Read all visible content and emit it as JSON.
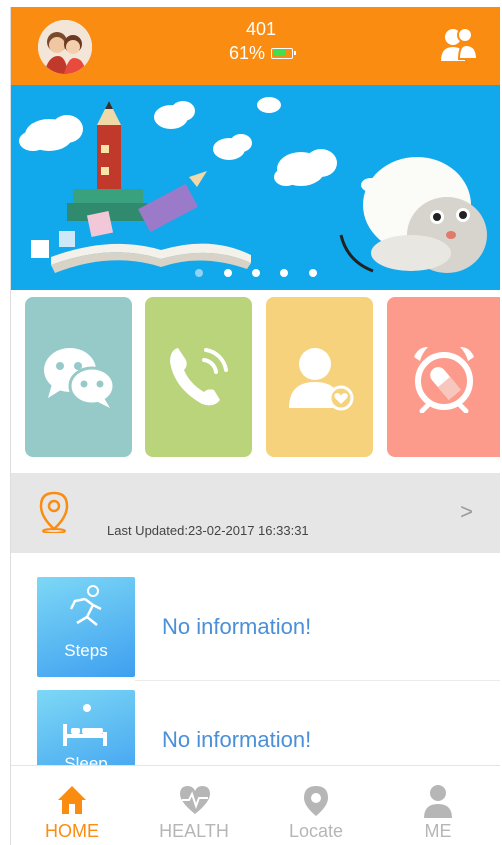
{
  "header": {
    "device_id": "401",
    "battery_percent": "61%",
    "avatar_icon": "family-avatar",
    "contacts_icon": "contacts-icon",
    "brand_color": "#fb8c12"
  },
  "banner": {
    "slide_count": 5,
    "active_slide": 0
  },
  "quick_actions": [
    {
      "icon": "chat-icon",
      "color": "#96cac9"
    },
    {
      "icon": "phone-call-icon",
      "color": "#b9d47b"
    },
    {
      "icon": "contact-heart-icon",
      "color": "#f6d27c"
    },
    {
      "icon": "alarm-pill-icon",
      "color": "#fc9a8b"
    }
  ],
  "location": {
    "text": "Last Updated:23-02-2017 16:33:31",
    "arrow": ">"
  },
  "info_cards": [
    {
      "label": "Steps",
      "value": "No information!"
    },
    {
      "label": "Sleep",
      "value": "No information!"
    }
  ],
  "nav": {
    "items": [
      {
        "label": "HOME",
        "icon": "home-icon",
        "active": true
      },
      {
        "label": "HEALTH",
        "icon": "heart-pulse-icon",
        "active": false
      },
      {
        "label": "Locate",
        "icon": "location-pin-icon",
        "active": false
      },
      {
        "label": "ME",
        "icon": "person-icon",
        "active": false
      }
    ]
  }
}
